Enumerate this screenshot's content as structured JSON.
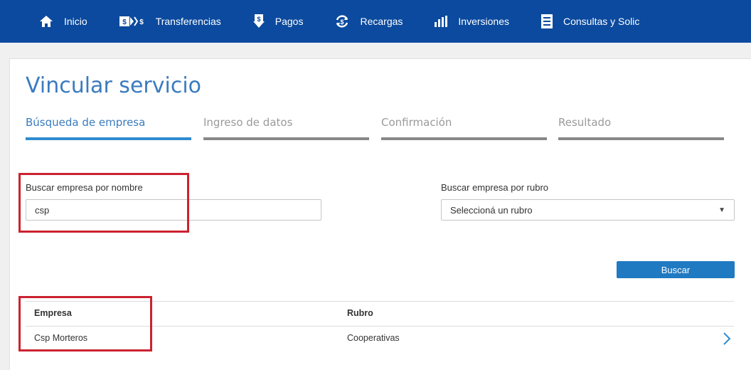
{
  "nav": {
    "items": [
      {
        "label": "Inicio",
        "icon": "home-icon"
      },
      {
        "label": "Transferencias",
        "icon": "transfer-icon"
      },
      {
        "label": "Pagos",
        "icon": "payment-icon"
      },
      {
        "label": "Recargas",
        "icon": "recharge-icon"
      },
      {
        "label": "Inversiones",
        "icon": "investments-icon"
      },
      {
        "label": "Consultas y Solic",
        "icon": "document-icon"
      }
    ]
  },
  "page": {
    "title": "Vincular servicio"
  },
  "steps": [
    {
      "label": "Búsqueda de empresa",
      "active": true
    },
    {
      "label": "Ingreso de datos",
      "active": false
    },
    {
      "label": "Confirmación",
      "active": false
    },
    {
      "label": "Resultado",
      "active": false
    }
  ],
  "search": {
    "name_label": "Buscar empresa por nombre",
    "name_value": "csp",
    "rubro_label": "Buscar empresa por rubro",
    "rubro_selected": "Seleccioná un rubro",
    "button_label": "Buscar"
  },
  "results": {
    "headers": {
      "empresa": "Empresa",
      "rubro": "Rubro"
    },
    "rows": [
      {
        "empresa": "Csp Morteros",
        "rubro": "Cooperativas"
      }
    ]
  },
  "colors": {
    "nav_bg": "#0b4a9e",
    "accent": "#2f8ccf",
    "button": "#1f7ac2",
    "annotation": "#cc2230"
  }
}
